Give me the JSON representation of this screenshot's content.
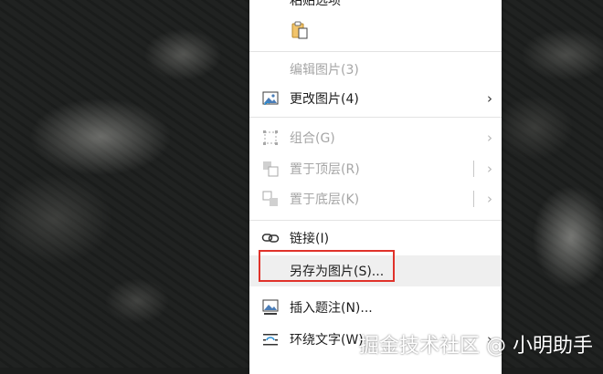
{
  "menu": {
    "top_cut_label": "粘贴选项",
    "items": [
      {
        "label": "编辑图片(3)",
        "disabled": true
      },
      {
        "label": "更改图片(4)",
        "disabled": false
      },
      {
        "label": "组合(G)",
        "disabled": true
      },
      {
        "label": "置于顶层(R)",
        "disabled": true
      },
      {
        "label": "置于底层(K)",
        "disabled": true
      },
      {
        "label": "链接(I)",
        "disabled": false
      },
      {
        "label": "另存为图片(S)...",
        "disabled": false
      },
      {
        "label": "插入题注(N)...",
        "disabled": false
      },
      {
        "label": "环绕文字(W)",
        "disabled": false
      }
    ]
  },
  "watermark": "掘金技术社区 @ 小明助手",
  "colors": {
    "highlight_box": "#e0322a",
    "menu_bg": "#ffffff",
    "disabled_text": "#a6a6a6"
  }
}
